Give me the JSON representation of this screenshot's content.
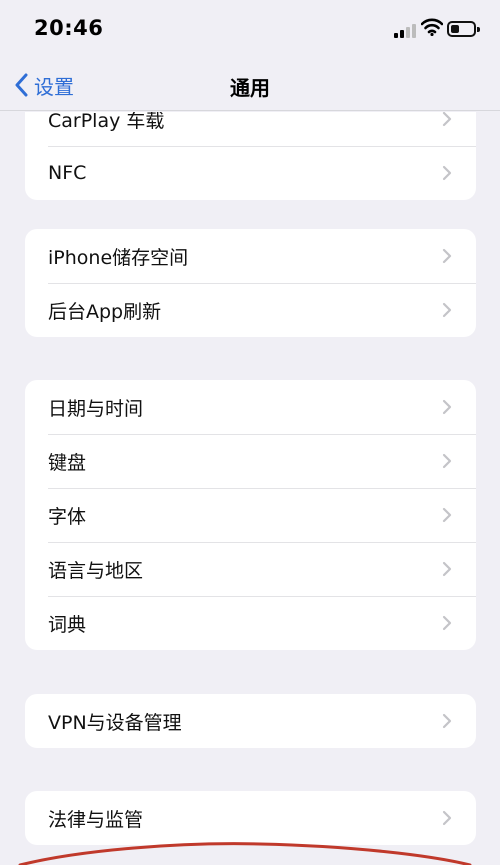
{
  "status_bar": {
    "time": "20:46",
    "icons": [
      "cellular-signal-icon",
      "wifi-icon",
      "battery-icon"
    ]
  },
  "nav": {
    "back_label": "设置",
    "title": "通用"
  },
  "partial_row_label": "CarPlay 车载",
  "groups": [
    {
      "items": [
        "NFC"
      ]
    },
    {
      "items": [
        "iPhone储存空间",
        "后台App刷新"
      ]
    },
    {
      "items": [
        "日期与时间",
        "键盘",
        "字体",
        "语言与地区",
        "词典"
      ]
    },
    {
      "items": [
        "VPN与设备管理"
      ]
    },
    {
      "items": [
        "法律与监管"
      ]
    }
  ],
  "colors": {
    "background": "#f0eff5",
    "card": "#ffffff",
    "accent": "#2f6ed6",
    "chevron": "#c4c4c8",
    "annotation_ink": "#c0392b"
  }
}
